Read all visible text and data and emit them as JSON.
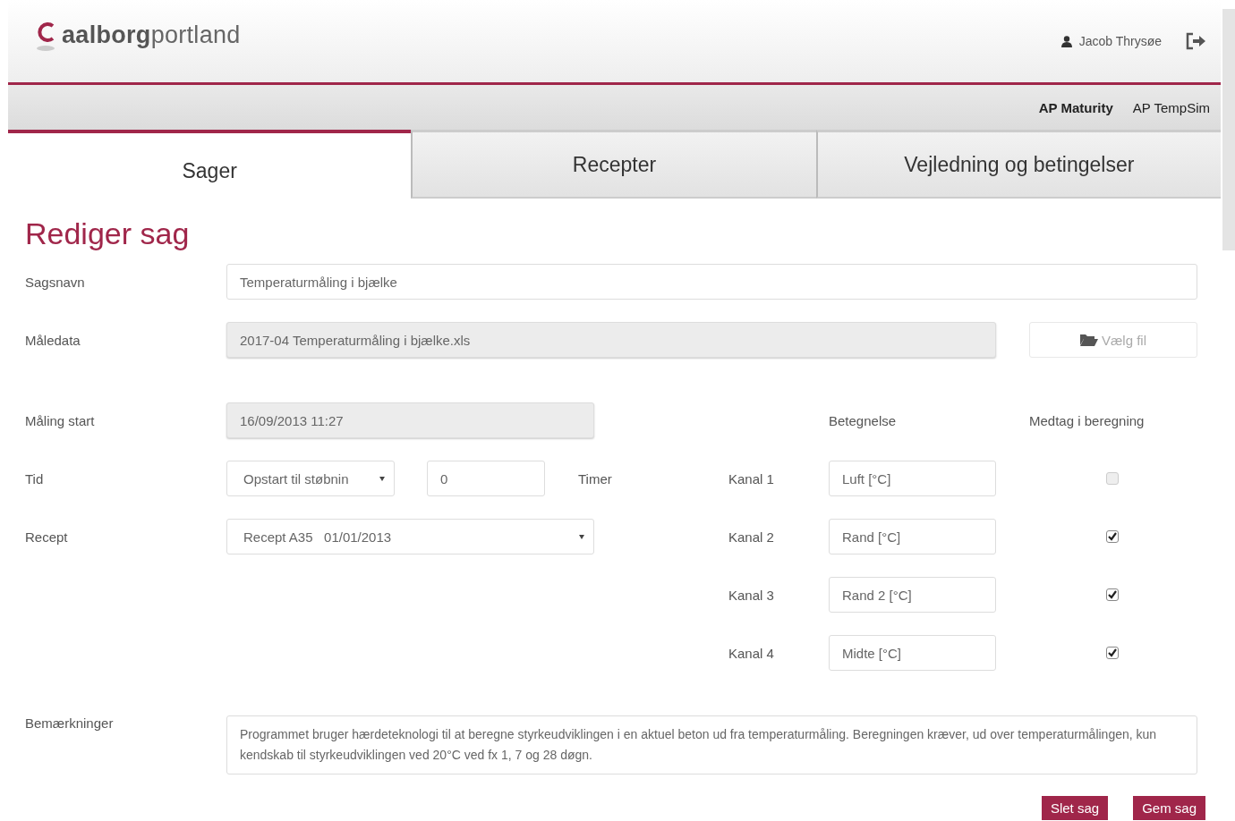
{
  "header": {
    "logo": {
      "bold": "aalborg",
      "light": "portland"
    },
    "user": "Jacob Thrysøe"
  },
  "app_links": [
    {
      "label": "AP Maturity",
      "selected": true
    },
    {
      "label": "AP TempSim",
      "selected": false
    }
  ],
  "tabs": [
    {
      "label": "Sager",
      "selected": true
    },
    {
      "label": "Recepter",
      "selected": false
    },
    {
      "label": "Vejledning og betingelser",
      "selected": false
    }
  ],
  "page_title": "Rediger sag",
  "form": {
    "case_name": {
      "label": "Sagsnavn",
      "value": "Temperaturmåling i bjælke"
    },
    "data_file": {
      "label": "Måledata",
      "value": "2017-04 Temperaturmåling i bjælke.xls",
      "button": "Vælg fil"
    },
    "start": {
      "label": "Måling start",
      "value": "16/09/2013 11:27"
    },
    "time": {
      "label": "Tid",
      "select": "Opstart til støbnin",
      "value": "0",
      "unit": "Timer"
    },
    "recipe": {
      "label": "Recept",
      "select": "Recept A35   01/01/2013"
    },
    "channel_headers": [
      "Betegnelse",
      "Medtag i beregning"
    ],
    "channels": [
      {
        "label": "Kanal 1",
        "value": "Luft [°C]",
        "checked": false,
        "disabled": true
      },
      {
        "label": "Kanal 2",
        "value": "Rand [°C]",
        "checked": true,
        "disabled": false
      },
      {
        "label": "Kanal 3",
        "value": "Rand 2 [°C]",
        "checked": true,
        "disabled": false
      },
      {
        "label": "Kanal 4",
        "value": "Midte [°C]",
        "checked": true,
        "disabled": false
      }
    ],
    "remarks": {
      "label": "Bemærkninger",
      "value": "Programmet bruger hærdeteknologi til at beregne styrkeudviklingen i en aktuel beton ud fra temperaturmåling. Beregningen kræver, ud over temperaturmålingen, kun kendskab til styrkeudviklingen ved 20°C ved fx 1, 7 og 28 døgn."
    }
  },
  "buttons": [
    "Slet sag",
    "Gem sag"
  ]
}
